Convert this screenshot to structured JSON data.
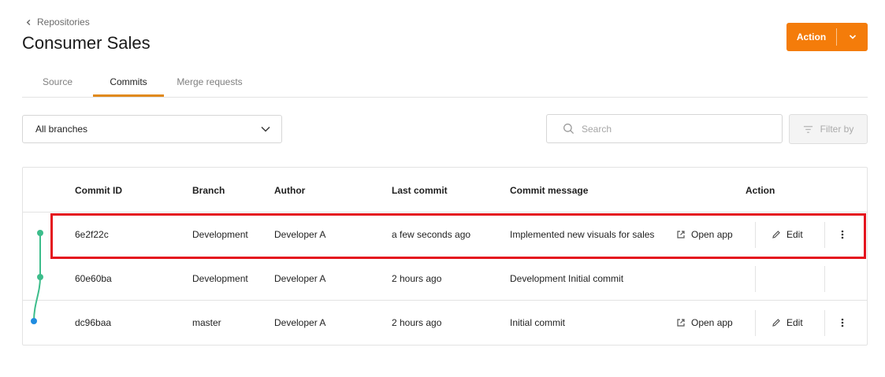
{
  "breadcrumb": {
    "label": "Repositories"
  },
  "page": {
    "title": "Consumer Sales"
  },
  "header": {
    "action_label": "Action"
  },
  "tabs": [
    {
      "label": "Source"
    },
    {
      "label": "Commits",
      "active": true
    },
    {
      "label": "Merge requests"
    }
  ],
  "toolbar": {
    "branch_select": {
      "value": "All branches"
    },
    "search": {
      "placeholder": "Search"
    },
    "filter_label": "Filter by"
  },
  "table": {
    "columns": [
      "Commit ID",
      "Branch",
      "Author",
      "Last commit",
      "Commit message",
      "Action"
    ],
    "rows": [
      {
        "commit_id": "6e2f22c",
        "branch": "Development",
        "author": "Developer A",
        "last_commit": "a few seconds ago",
        "message": "Implemented new visuals for sales",
        "open_app": "Open app",
        "edit": "Edit",
        "graph_color": "#3dbd8b",
        "highlighted": true
      },
      {
        "commit_id": "60e60ba",
        "branch": "Development",
        "author": "Developer A",
        "last_commit": "2 hours ago",
        "message": "Development Initial commit",
        "open_app": "",
        "edit": "",
        "graph_color": "#3dbd8b"
      },
      {
        "commit_id": "dc96baa",
        "branch": "master",
        "author": "Developer A",
        "last_commit": "2 hours ago",
        "message": "Initial commit",
        "open_app": "Open app",
        "edit": "Edit",
        "graph_color": "#1f8ce0"
      }
    ]
  },
  "colors": {
    "accent": "#f47c0a",
    "tab_indicator": "#e08a1e",
    "highlight_border": "#e4141e",
    "branch_development": "#3dbd8b",
    "branch_master": "#1f8ce0"
  },
  "icons": {
    "breadcrumb": "chevron-left-icon",
    "action_dropdown": "chevron-down-icon",
    "select": "chevron-down-icon",
    "search": "search-icon",
    "filter": "filter-icon",
    "open_app": "external-link-icon",
    "edit": "pencil-icon",
    "more": "more-vertical-icon"
  }
}
